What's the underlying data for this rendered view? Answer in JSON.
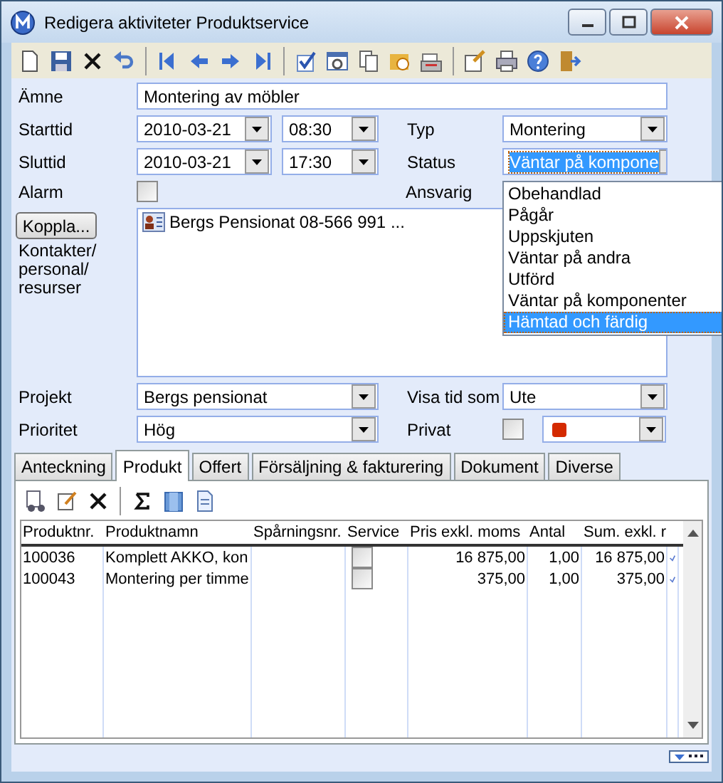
{
  "window": {
    "title": "Redigera aktiviteter Produktservice"
  },
  "form": {
    "subject": {
      "label": "Ämne",
      "value": "Montering av möbler"
    },
    "start": {
      "label": "Starttid",
      "date": "2010-03-21",
      "time": "08:30"
    },
    "end": {
      "label": "Sluttid",
      "date": "2010-03-21",
      "time": "17:30"
    },
    "type": {
      "label": "Typ",
      "value": "Montering"
    },
    "status": {
      "label": "Status",
      "value": "Väntar på kompone",
      "focused": true
    },
    "alarm": {
      "label": "Alarm",
      "checked": false
    },
    "responsible": {
      "label": "Ansvarig"
    },
    "connect_button": "Koppla...",
    "contacts_label": "Kontakter/ personal/ resurser",
    "contacts": [
      "Bergs Pensionat 08-566 991 ..."
    ],
    "project": {
      "label": "Projekt",
      "value": "Bergs pensionat"
    },
    "show_time_as": {
      "label": "Visa tid som",
      "value": "Ute"
    },
    "priority": {
      "label": "Prioritet",
      "value": "Hög"
    },
    "private": {
      "label": "Privat",
      "checked": false
    },
    "category": {
      "color": "#d42a00"
    }
  },
  "status_dropdown": [
    {
      "label": "Obehandlad",
      "selected": false
    },
    {
      "label": "Pågår",
      "selected": false
    },
    {
      "label": "Uppskjuten",
      "selected": false
    },
    {
      "label": "Väntar på andra",
      "selected": false
    },
    {
      "label": "Utförd",
      "selected": false
    },
    {
      "label": "Väntar på komponenter",
      "selected": false
    },
    {
      "label": "Hämtad och färdig",
      "selected": true
    }
  ],
  "tabs": [
    {
      "label": "Anteckning",
      "selected": false
    },
    {
      "label": "Produkt",
      "selected": true
    },
    {
      "label": "Offert",
      "selected": false
    },
    {
      "label": "Försäljning & fakturering",
      "selected": false
    },
    {
      "label": "Dokument",
      "selected": false
    },
    {
      "label": "Diverse",
      "selected": false
    }
  ],
  "table": {
    "columns": [
      "Produktnr.",
      "Produktnamn",
      "Spårningsnr.",
      "Service",
      "Pris exkl. moms",
      "Antal",
      "Sum. exkl. r"
    ],
    "rows": [
      {
        "number": "100036",
        "name": "Komplett AKKO, kon",
        "tracking": "",
        "service": false,
        "price": "16 875,00",
        "quantity": "1,00",
        "sum": "16 875,00"
      },
      {
        "number": "100043",
        "name": "Montering per timme",
        "tracking": "",
        "service": false,
        "price": "375,00",
        "quantity": "1,00",
        "sum": "375,00"
      }
    ]
  }
}
